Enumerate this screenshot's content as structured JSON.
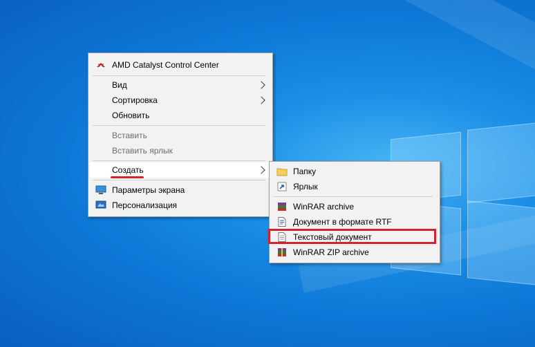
{
  "context_menu": {
    "items": [
      {
        "label": "AMD Catalyst Control Center",
        "icon": "amd-catalyst-icon"
      },
      {
        "label": "Вид",
        "has_submenu": true
      },
      {
        "label": "Сортировка",
        "has_submenu": true
      },
      {
        "label": "Обновить"
      },
      {
        "label": "Вставить",
        "disabled": true
      },
      {
        "label": "Вставить ярлык",
        "disabled": true
      },
      {
        "label": "Создать",
        "has_submenu": true,
        "highlighted": true
      },
      {
        "label": "Параметры экрана",
        "icon": "display-settings-icon"
      },
      {
        "label": "Персонализация",
        "icon": "personalization-icon"
      }
    ]
  },
  "submenu_create": {
    "items": [
      {
        "label": "Папку",
        "icon": "folder-icon"
      },
      {
        "label": "Ярлык",
        "icon": "shortcut-icon"
      },
      {
        "label": "WinRAR archive",
        "icon": "winrar-icon"
      },
      {
        "label": "Документ в формате RTF",
        "icon": "rtf-document-icon"
      },
      {
        "label": "Текстовый документ",
        "icon": "text-document-icon",
        "annotated": true
      },
      {
        "label": "WinRAR ZIP archive",
        "icon": "winrar-zip-icon"
      }
    ]
  },
  "annotation_color": "#d3232e",
  "wallpaper_color": "#0d77d6"
}
